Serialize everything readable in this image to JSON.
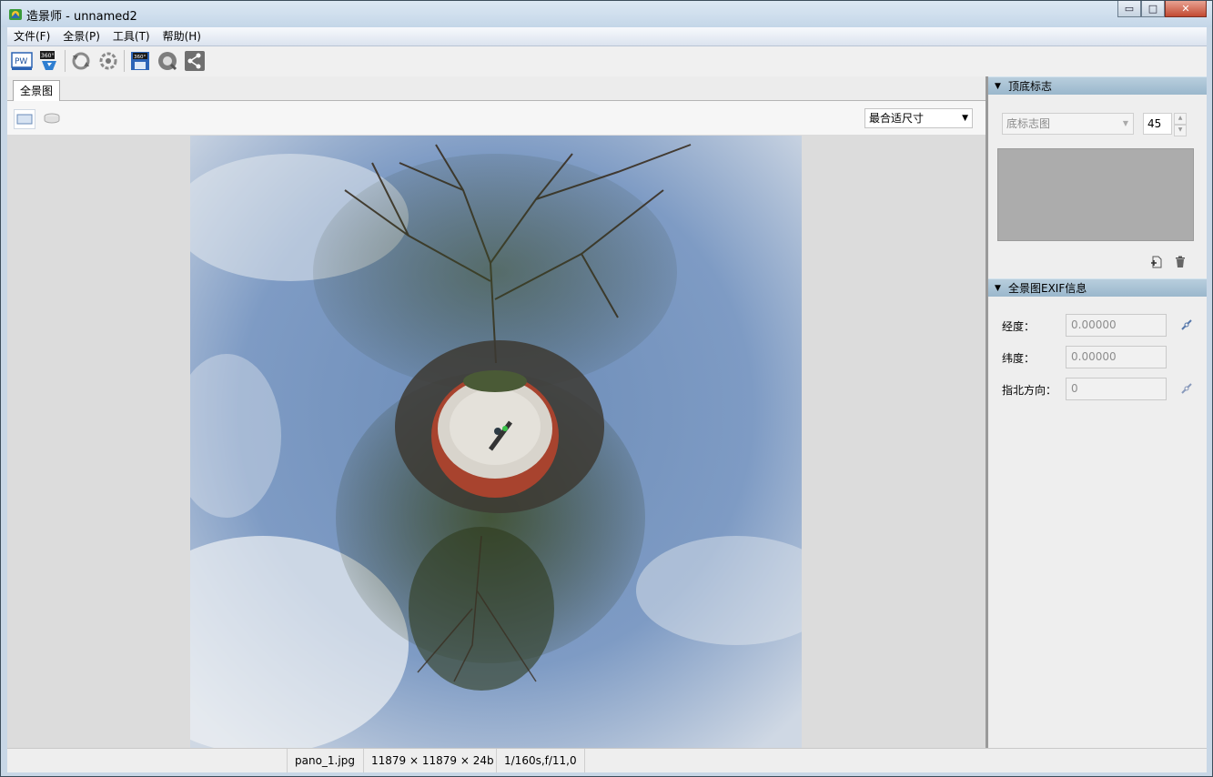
{
  "window": {
    "title": "造景师 - unnamed2",
    "minimize_label": "▭",
    "maximize_label": "□",
    "close_label": "✕"
  },
  "menu": {
    "items": [
      {
        "label": "文件(F)"
      },
      {
        "label": "全景(P)"
      },
      {
        "label": "工具(T)"
      },
      {
        "label": "帮助(H)"
      }
    ]
  },
  "toolbar": {
    "buttons": [
      {
        "icon": "pw-icon"
      },
      {
        "icon": "360-import-icon"
      },
      {
        "icon": "rotate-left-icon"
      },
      {
        "icon": "rotate-settings-icon"
      },
      {
        "icon": "save-360-icon"
      },
      {
        "icon": "preview-icon"
      },
      {
        "icon": "share-icon"
      }
    ]
  },
  "left": {
    "tab_label": "全景图",
    "fit_select_value": "最合适尺寸"
  },
  "right": {
    "top_bottom_logo": {
      "header": "顶底标志",
      "logo_type_value": "底标志图",
      "size_value": "45"
    },
    "exif": {
      "header": "全景图EXIF信息",
      "longitude_label": "经度：",
      "longitude_value": "0.00000",
      "latitude_label": "纬度：",
      "latitude_value": "0.00000",
      "north_label": "指北方向：",
      "north_value": "0"
    }
  },
  "status": {
    "filename": "pano_1.jpg",
    "dimensions": "11879 × 11879 × 24b",
    "exposure": "1/160s,f/11,0"
  }
}
